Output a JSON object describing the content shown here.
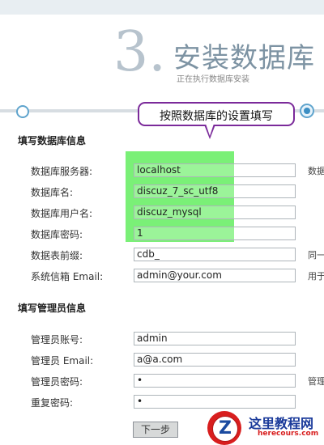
{
  "header": {
    "step_number": "3.",
    "title": "安装数据库",
    "subtitle": "正在执行数据库安装"
  },
  "tooltip": "按照数据库的设置填写",
  "database_section": {
    "title": "填写数据库信息",
    "rows": [
      {
        "label": "数据库服务器:",
        "value": "localhost",
        "note": "数据"
      },
      {
        "label": "数据库名:",
        "value": "discuz_7_sc_utf8",
        "note": ""
      },
      {
        "label": "数据库用户名:",
        "value": "discuz_mysql",
        "note": ""
      },
      {
        "label": "数据库密码:",
        "value": "1",
        "note": ""
      },
      {
        "label": "数据表前缀:",
        "value": "cdb_",
        "note": "同一"
      },
      {
        "label": "系统信箱 Email:",
        "value": "admin@your.com",
        "note": "用于"
      }
    ]
  },
  "admin_section": {
    "title": "填写管理员信息",
    "rows": [
      {
        "label": "管理员账号:",
        "value": "admin",
        "note": ""
      },
      {
        "label": "管理员 Email:",
        "value": "a@a.com",
        "note": ""
      },
      {
        "label": "管理员密码:",
        "value": "•",
        "note": "管理"
      },
      {
        "label": "重复密码:",
        "value": "•",
        "note": ""
      }
    ]
  },
  "next_button": "下一步",
  "watermark": {
    "badge": "Z",
    "name": "这里教程网",
    "url": "herecours.com"
  },
  "colors": {
    "highlight": "#6fef6b",
    "tooltip_border": "#7b2a9a",
    "progress_accent": "#3c8fc4"
  }
}
